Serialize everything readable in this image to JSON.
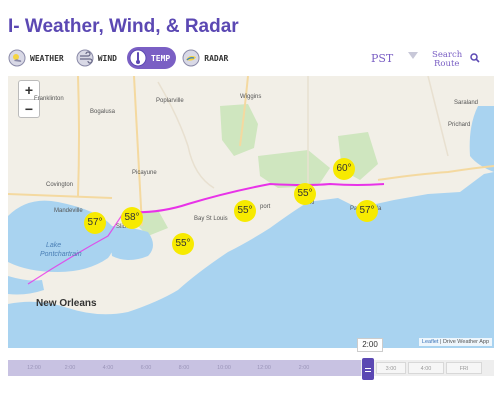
{
  "header": {
    "title": "I- Weather, Wind, & Radar"
  },
  "tabs": [
    {
      "label": "WEATHER",
      "icon": "weather-icon",
      "active": false
    },
    {
      "label": "WIND",
      "icon": "wind-icon",
      "active": false
    },
    {
      "label": "TEMP",
      "icon": "thermometer-icon",
      "active": true
    },
    {
      "label": "RADAR",
      "icon": "radar-icon",
      "active": false
    }
  ],
  "timezone": {
    "value": "PST"
  },
  "search": {
    "line1": "Search",
    "line2": "Route"
  },
  "map": {
    "zoom_in": "+",
    "zoom_out": "−",
    "places": {
      "franklinton": "Franklinton",
      "poplarville": "Poplarville",
      "wiggins": "Wiggins",
      "bogalusa": "Bogalusa",
      "picayune": "Picayune",
      "covington": "Covington",
      "mandeville": "Mandeville",
      "slidell": "Slidell",
      "bay_st_louis": "Bay St Louis",
      "gulfport": "port",
      "biloxi": "Biloxi",
      "pascagoula": "Pascagoula",
      "saraland": "Saraland",
      "prichard": "Prichard",
      "new_orleans": "New Orleans",
      "lake_pontchartrain_1": "Lake",
      "lake_pontchartrain_2": "Pontchartrain"
    },
    "temperatures": [
      "57°",
      "58°",
      "55°",
      "55°",
      "55°",
      "60°",
      "57°"
    ],
    "attribution": {
      "leaflet": "Leaflet",
      "separator": " | ",
      "credit": "Drive Weather App"
    }
  },
  "timeline": {
    "current_time": "2:00",
    "past_labels": [
      "12:00",
      "2:00",
      "4:00",
      "6:00",
      "8:00",
      "10:00",
      "12:00",
      "2:00"
    ],
    "future_labels": [
      "3:00",
      "4:00",
      "FRI"
    ]
  },
  "colors": {
    "accent": "#7a5fc4",
    "title": "#5b48b3",
    "temp_marker": "#f7ea00",
    "route": "#e832e8",
    "water": "#a9d3f0"
  }
}
